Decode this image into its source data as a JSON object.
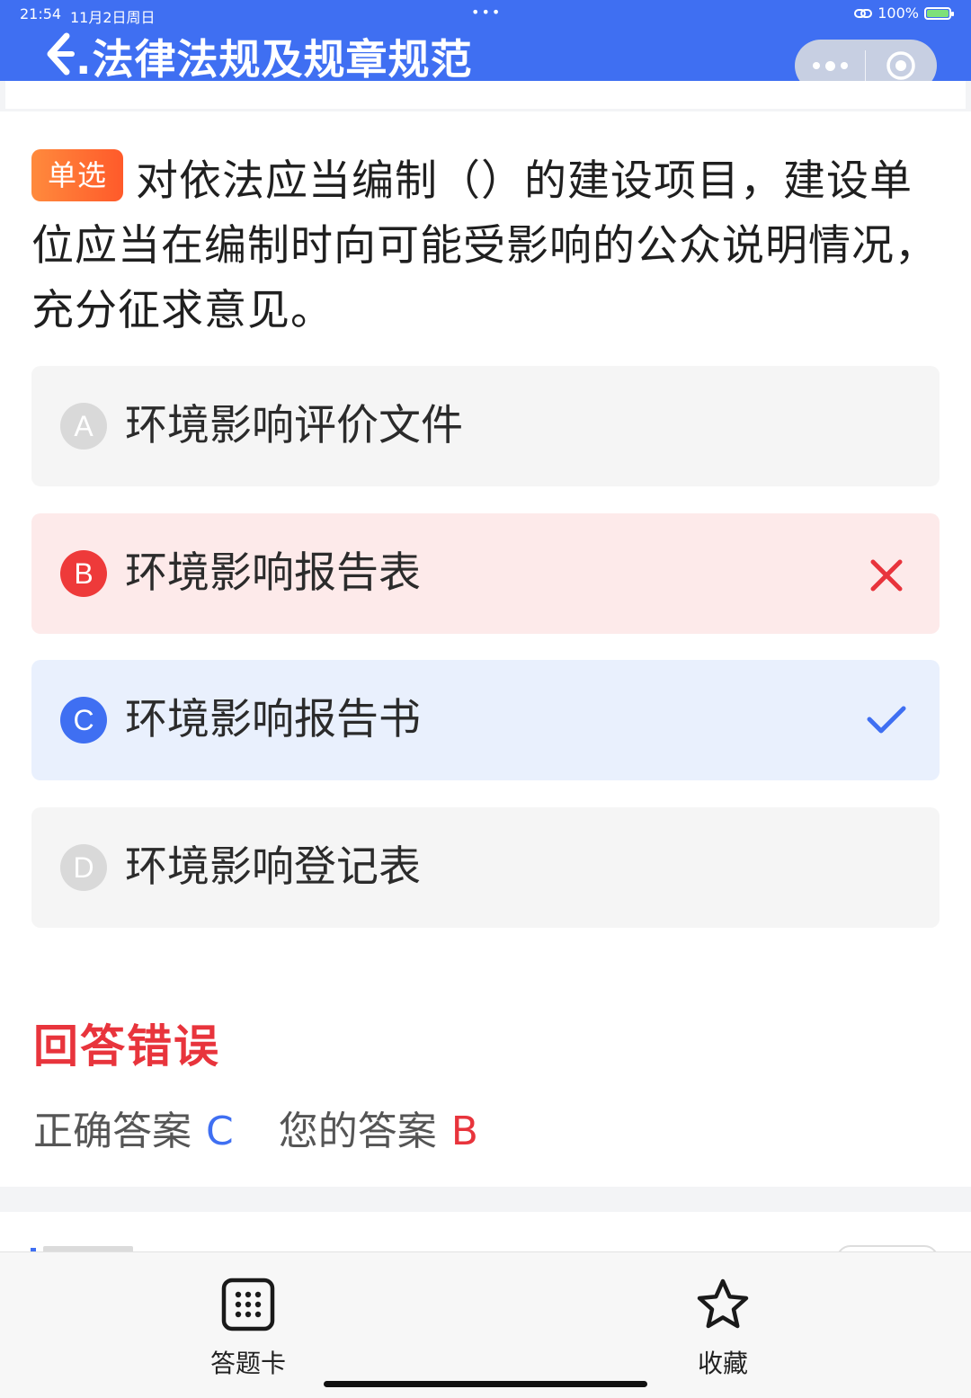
{
  "status_bar": {
    "time": "21:54",
    "date": "11月2日周日",
    "center_dots": "•••",
    "battery_text": "100%",
    "icons": [
      "link-icon",
      "battery-charging-icon"
    ]
  },
  "header": {
    "title": ".法律法规及规章规范",
    "back_icon": "back-arrow-icon",
    "capsule": {
      "more_icon": "more-dots-icon",
      "close_icon": "target-circle-icon"
    },
    "color": "#3f6ff2"
  },
  "question": {
    "type_tag": "单选",
    "text": "对依法应当编制（）的建设项目，建设单位应当在编制时向可能受影响的公众说明情况，充分征求意见。"
  },
  "options": [
    {
      "letter": "A",
      "text": "环境影响评价文件",
      "state": "neutral"
    },
    {
      "letter": "B",
      "text": "环境影响报告表",
      "state": "wrong",
      "mark_icon": "close-x-icon"
    },
    {
      "letter": "C",
      "text": "环境影响报告书",
      "state": "correct",
      "mark_icon": "checkmark-icon"
    },
    {
      "letter": "D",
      "text": "环境影响登记表",
      "state": "neutral"
    }
  ],
  "result": {
    "title": "回答错误",
    "correct_label": "正确答案",
    "correct_value": "C",
    "mine_label": "您的答案",
    "mine_value": "B",
    "colors": {
      "error": "#e8343c",
      "correct": "#3f6ff2"
    }
  },
  "bottom_bar": {
    "answer_card_label": "答题卡",
    "answer_card_icon": "grid-card-icon",
    "favorite_label": "收藏",
    "favorite_icon": "star-icon"
  }
}
